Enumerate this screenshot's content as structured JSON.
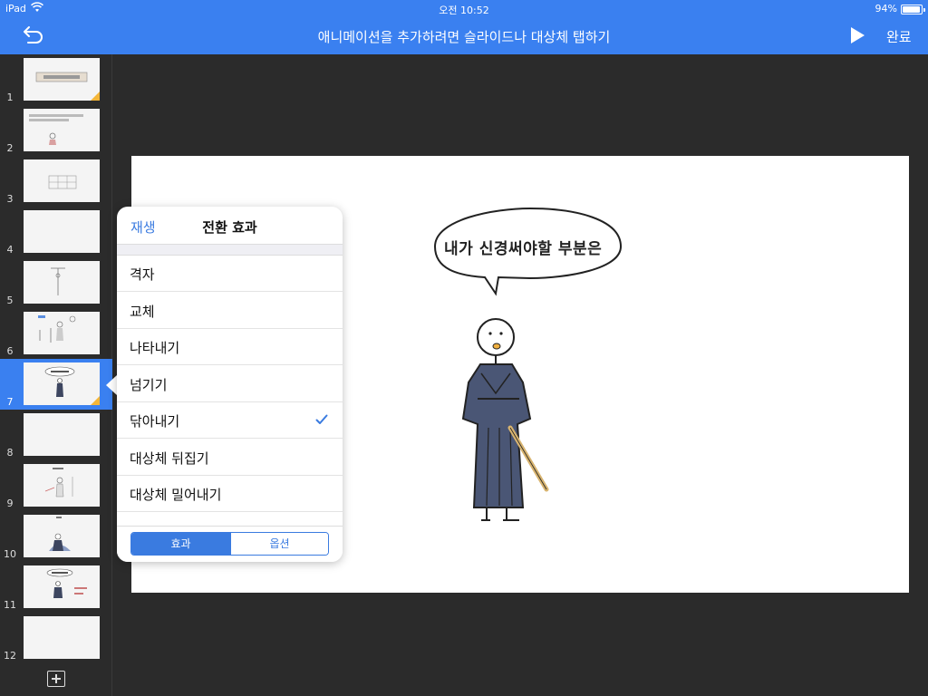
{
  "status_bar": {
    "device": "iPad",
    "time": "오전 10:52",
    "battery": "94%",
    "battery_level": 0.94
  },
  "nav": {
    "title": "애니메이션을 추가하려면 슬라이드나 대상체 탭하기",
    "done_label": "완료",
    "undo_icon": "undo-arrow-icon",
    "play_icon": "play-icon"
  },
  "slides": [
    {
      "number": "1"
    },
    {
      "number": "2"
    },
    {
      "number": "3"
    },
    {
      "number": "4"
    },
    {
      "number": "5"
    },
    {
      "number": "6"
    },
    {
      "number": "7"
    },
    {
      "number": "8"
    },
    {
      "number": "9"
    },
    {
      "number": "10"
    },
    {
      "number": "11"
    },
    {
      "number": "12"
    }
  ],
  "selected_slide": "7",
  "canvas": {
    "speech_bubble": "내가 신경써야할 부분은"
  },
  "popover": {
    "play_label": "재생",
    "title": "전환 효과",
    "items": [
      {
        "label": "격자"
      },
      {
        "label": "교체"
      },
      {
        "label": "나타내기"
      },
      {
        "label": "넘기기"
      },
      {
        "label": "닦아내기",
        "checked": true
      },
      {
        "label": "대상체 뒤집기"
      },
      {
        "label": "대상체 밀어내기"
      }
    ],
    "segments": {
      "effect": "효과",
      "options": "옵션"
    }
  },
  "colors": {
    "accent": "#3a80f0",
    "link": "#3a7be0",
    "thumb_badge": "#f4b638",
    "background": "#2b2b2b"
  }
}
